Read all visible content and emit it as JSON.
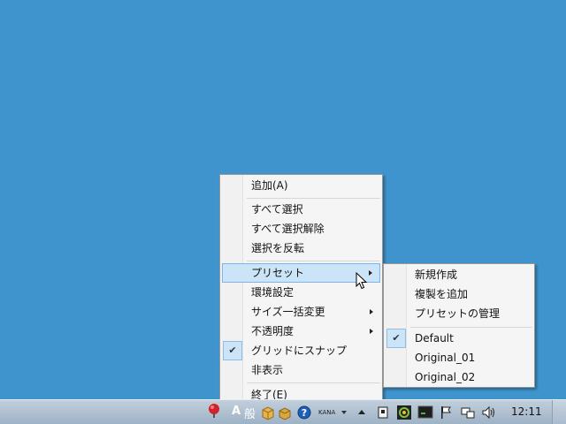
{
  "main_menu": {
    "items": [
      {
        "label": "追加(A)"
      },
      {
        "label": "すべて選択"
      },
      {
        "label": "すべて選択解除"
      },
      {
        "label": "選択を反転"
      },
      {
        "label": "プリセット"
      },
      {
        "label": "環境設定"
      },
      {
        "label": "サイズ一括変更"
      },
      {
        "label": "不透明度"
      },
      {
        "label": "グリッドにスナップ",
        "checked": true
      },
      {
        "label": "非表示"
      },
      {
        "label": "終了(E)"
      }
    ]
  },
  "preset_submenu": {
    "items": [
      {
        "label": "新規作成"
      },
      {
        "label": "複製を追加"
      },
      {
        "label": "プリセットの管理"
      },
      {
        "label": "Default",
        "checked": true
      },
      {
        "label": "Original_01"
      },
      {
        "label": "Original_02"
      }
    ]
  },
  "taskbar": {
    "ime_mode": "A",
    "ime_label": "般",
    "kana_label": "KANA",
    "clock": "12:11"
  },
  "colors": {
    "desktop": "#3f94cd",
    "menu_bg": "#f5f5f5",
    "highlight": "#cce4f7"
  },
  "icons": [
    "ruby-icon",
    "package-icon",
    "box-icon",
    "help-icon",
    "dropdown-arrow-icon",
    "show-hidden-icons-arrow",
    "usb-icon",
    "qt-icon",
    "terminal-icon",
    "flag-icon",
    "network-icon",
    "speaker-icon",
    "show-desktop-button"
  ]
}
